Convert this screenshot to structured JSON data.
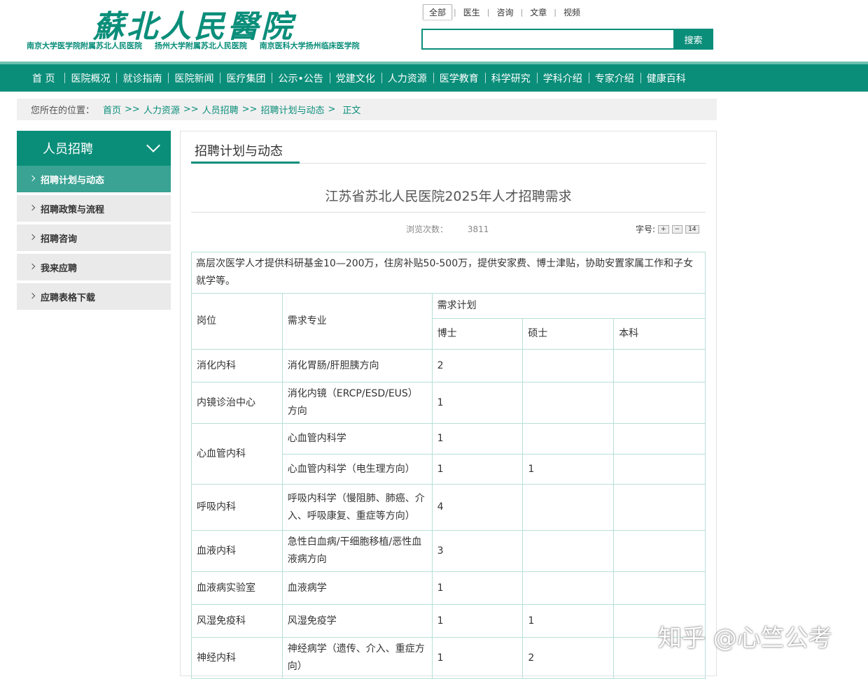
{
  "header": {
    "logo_title": "蘇北人民醫院",
    "logo_subs": [
      "南京大学医学院附属苏北人民医院",
      "扬州大学附属苏北人民医院",
      "南京医科大学扬州临床医学院"
    ],
    "search_tabs": [
      "全部",
      "医生",
      "咨询",
      "文章",
      "视频"
    ],
    "search_button": "搜索"
  },
  "nav": {
    "items": [
      "首 页",
      "医院概况",
      "就诊指南",
      "医院新闻",
      "医疗集团",
      "公示•公告",
      "党建文化",
      "人力资源",
      "医学教育",
      "科学研究",
      "学科介绍",
      "专家介绍",
      "健康百科"
    ]
  },
  "breadcrumb": {
    "prefix": "您所在的位置：",
    "items": [
      "首页",
      "人力资源",
      "人员招聘",
      "招聘计划与动态",
      "正文"
    ],
    "seps": [
      ">>",
      ">>",
      ">>",
      ">"
    ]
  },
  "sidebar": {
    "title": "人员招聘",
    "items": [
      "招聘计划与动态",
      "招聘政策与流程",
      "招聘咨询",
      "我来应聘",
      "应聘表格下载"
    ]
  },
  "main": {
    "section_title": "招聘计划与动态",
    "article_title": "江苏省苏北人民医院2025年人才招聘需求",
    "views_label": "浏览次数：",
    "views_count": "3811",
    "font_label": "字号:",
    "font_buttons": [
      "+",
      "−",
      "14"
    ]
  },
  "table": {
    "intro": "高层次医学人才提供科研基金10—200万，住房补贴50-500万，提供安家费、博士津贴，协助安置家属工作和子女就学等。",
    "headers": {
      "position": "岗位",
      "major": "需求专业",
      "plan": "需求计划",
      "phd": "博士",
      "master": "硕士",
      "bachelor": "本科"
    },
    "rows": [
      {
        "dept": "消化内科",
        "major": "消化胃肠/肝胆胰方向",
        "phd": "2",
        "master": "",
        "bachelor": ""
      },
      {
        "dept": "内镜诊治中心",
        "major": "消化内镜（ERCP/ESD/EUS）方向",
        "phd": "1",
        "master": "",
        "bachelor": ""
      },
      {
        "dept": "心血管内科",
        "major": "心血管内科学",
        "phd": "1",
        "master": "",
        "bachelor": ""
      },
      {
        "dept": "",
        "major": "心血管内科学（电生理方向）",
        "phd": "1",
        "master": "1",
        "bachelor": ""
      },
      {
        "dept": "呼吸内科",
        "major": "呼吸内科学（慢阻肺、肺癌、介入、呼吸康复、重症等方向）",
        "phd": "4",
        "master": "",
        "bachelor": ""
      },
      {
        "dept": "血液内科",
        "major": "急性白血病/干细胞移植/恶性血液病方向",
        "phd": "3",
        "master": "",
        "bachelor": ""
      },
      {
        "dept": "血液病实验室",
        "major": "血液病学",
        "phd": "1",
        "master": "",
        "bachelor": ""
      },
      {
        "dept": "风湿免疫科",
        "major": "风湿免疫学",
        "phd": "1",
        "master": "1",
        "bachelor": ""
      },
      {
        "dept": "神经内科",
        "major": "神经病学（遗传、介入、重症方向）",
        "phd": "1",
        "master": "2",
        "bachelor": ""
      }
    ]
  },
  "watermark": "知乎 @心竺公考"
}
